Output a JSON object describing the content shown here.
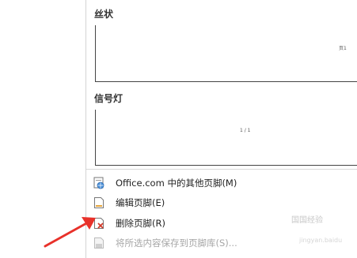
{
  "gallery": {
    "sections": [
      {
        "title": "丝状",
        "preview_text": "页1"
      },
      {
        "title": "信号灯",
        "preview_text": "1 / 1"
      }
    ]
  },
  "menu": {
    "items": [
      {
        "label": "Office.com 中的其他页脚(M)",
        "icon": "office-web-icon",
        "enabled": true
      },
      {
        "label": "编辑页脚(E)",
        "icon": "edit-footer-icon",
        "enabled": true
      },
      {
        "label": "删除页脚(R)",
        "icon": "remove-footer-icon",
        "enabled": true
      },
      {
        "label": "将所选内容保存到页脚库(S)...",
        "icon": "save-selection-icon",
        "enabled": false
      }
    ]
  },
  "watermark": {
    "text": "国国经验",
    "sub": "jingyan.baidu"
  },
  "colors": {
    "arrow": "#e8312a",
    "remove_x": "#d23a2a"
  }
}
